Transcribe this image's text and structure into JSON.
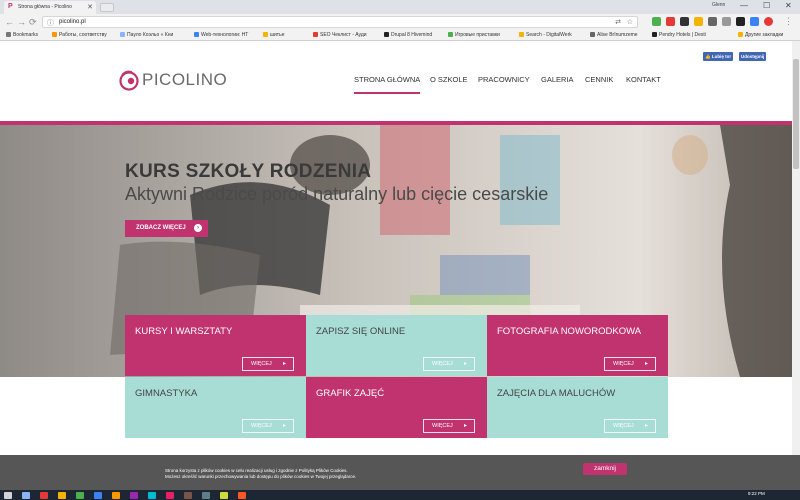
{
  "browser": {
    "tab_title": "Strona główna - Picolino",
    "tab_close": "✕",
    "url": "picolino.pl",
    "user": "Glenn",
    "win_min": "—",
    "win_max": "☐",
    "win_close": "✕",
    "back": "←",
    "forward": "→",
    "reload": "⟳",
    "bookmarks": [
      {
        "label": "Bookmarks",
        "color": "#777"
      },
      {
        "label": "Работы, соответству",
        "color": "#ff9800"
      },
      {
        "label": "Пауло Коэльо « Кни",
        "color": "#8ab4f8"
      },
      {
        "label": "Web-технологии: НТ",
        "color": "#3b82f6"
      },
      {
        "label": "шитье",
        "color": "#f4b400"
      },
      {
        "label": "SEO Чеклист - Ауди",
        "color": "#e53935"
      },
      {
        "label": "Drupal 8 Hivemind",
        "color": "#222"
      },
      {
        "label": "Игровые приставки",
        "color": "#4caf50"
      },
      {
        "label": "Search - DigitalWerk",
        "color": "#f4b400"
      },
      {
        "label": "Alise Brīnumzeme",
        "color": "#666"
      },
      {
        "label": "Pendry Hotels | Desti",
        "color": "#222"
      },
      {
        "label": "Другие закладки",
        "color": "#f4b400"
      }
    ]
  },
  "site": {
    "logo_text": "PICOLINO",
    "nav": [
      "STRONA GŁÓWNA",
      "O SZKOLE",
      "PRACOWNICY",
      "GALERIA",
      "CENNIK",
      "KONTAKT"
    ],
    "fb_like": "Lubię to!",
    "fb_share": "Udostępnij",
    "hero": {
      "title": "KURS SZKOŁY RODZENIA",
      "subtitle": "Aktywni Rodzice poród naturalny lub cięcie cesarskie",
      "button": "ZOBACZ WIĘCEJ",
      "button_icon": "›"
    },
    "tiles": [
      {
        "title": "KURSY I WARSZTATY",
        "button": "WIĘCEJ"
      },
      {
        "title": "ZAPISZ SIĘ ONLINE",
        "button": "WIĘCEJ"
      },
      {
        "title": "FOTOGRAFIA NOWORODKOWA",
        "button": "WIĘCEJ"
      },
      {
        "title": "GIMNASTYKA",
        "button": "WIĘCEJ"
      },
      {
        "title": "GRAFIK ZAJĘĆ",
        "button": "WIĘCEJ"
      },
      {
        "title": "ZAJĘCIA DLA MALUCHÓW",
        "button": "WIĘCEJ"
      }
    ],
    "tile_arrow": "▸",
    "cookie": {
      "line1": "Strona korzysta z plików cookies w celu realizacji usług i zgodnie z Polityką Plików Cookies.",
      "line2": "Możesz określić warunki przechowywania lub dostępu do plików cookies w Twojej przeglądarce.",
      "button": "zamknij"
    }
  },
  "taskbar": {
    "time": "9:22 PM",
    "date": "08.11.2017"
  },
  "colors": {
    "brand": "#c0336f",
    "mint": "#a8ddd6"
  }
}
